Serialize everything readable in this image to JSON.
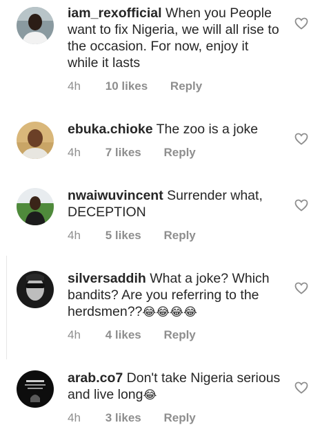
{
  "comments": [
    {
      "username": "iam_rexofficial",
      "text": "When you People want to fix Nigeria, we will all rise to the occasion. For now, enjoy it while it lasts",
      "emoji": "",
      "time": "4h",
      "likes": "10 likes",
      "reply": "Reply",
      "avatar": "avatar-man-white-shirt"
    },
    {
      "username": "ebuka.chioke",
      "text": "The zoo is a joke",
      "emoji": "",
      "time": "4h",
      "likes": "7 likes",
      "reply": "Reply",
      "avatar": "avatar-man-outdoor"
    },
    {
      "username": "nwaiwuvincent",
      "text": "Surrender what, DECEPTION",
      "emoji": "",
      "time": "4h",
      "likes": "5 likes",
      "reply": "Reply",
      "avatar": "avatar-man-field"
    },
    {
      "username": "silversaddih",
      "text": "What a joke? Which bandits? Are you referring to the herdsmen??",
      "emoji": "😂😂😂😂",
      "time": "4h",
      "likes": "4 likes",
      "reply": "Reply",
      "avatar": "avatar-monochrome-face"
    },
    {
      "username": "arab.co7",
      "text": "Don't take Nigeria serious and live long",
      "emoji": "😂",
      "time": "4h",
      "likes": "3 likes",
      "reply": "Reply",
      "avatar": "avatar-dark-logo"
    }
  ],
  "colors": {
    "text": "#262626",
    "meta": "#8e8e8e",
    "heart_stroke": "#8e8e8e"
  },
  "icons": {
    "like": "heart-outline-icon"
  }
}
